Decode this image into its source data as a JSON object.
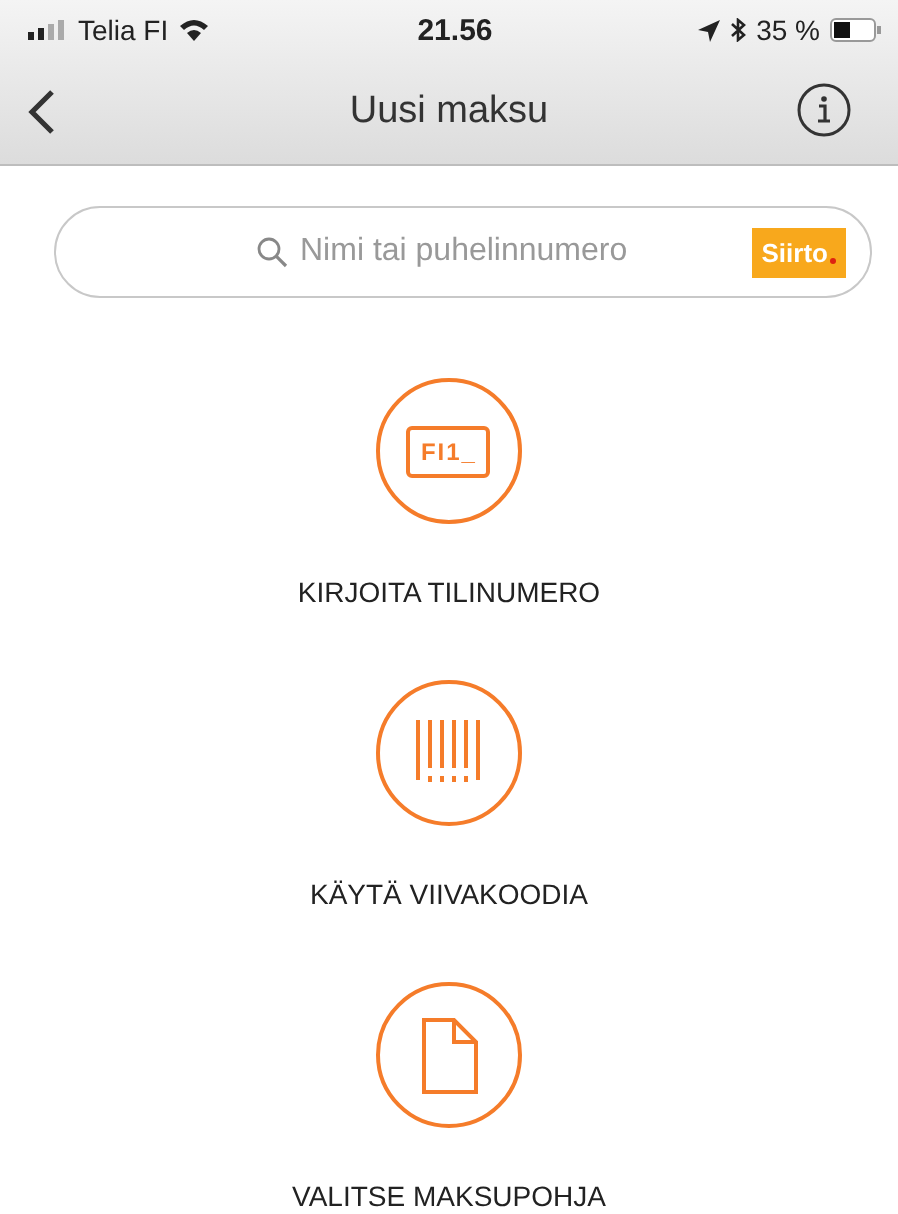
{
  "status_bar": {
    "carrier": "Telia FI",
    "time": "21.56",
    "battery": "35 %"
  },
  "nav": {
    "title": "Uusi maksu"
  },
  "search": {
    "placeholder": "Nimi tai puhelinnumero",
    "badge": "Siirto"
  },
  "actions": [
    {
      "kind": "account",
      "icon_text": "FI1_",
      "label": "KIRJOITA TILINUMERO"
    },
    {
      "kind": "barcode",
      "label": "KÄYTÄ VIIVAKOODIA"
    },
    {
      "kind": "template",
      "label": "VALITSE MAKSUPOHJA"
    }
  ]
}
